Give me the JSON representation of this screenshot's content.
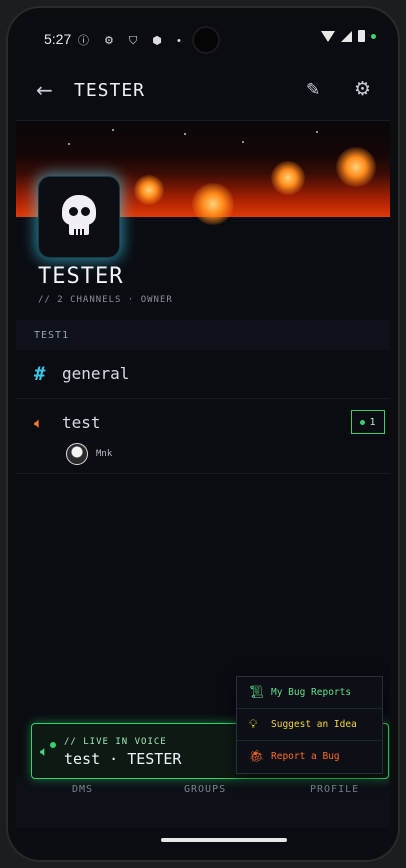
{
  "status_bar": {
    "time": "5:27",
    "icons": "ⓘ ⚙ ⛉ ⬢ •"
  },
  "app_bar": {
    "title": "TESTER"
  },
  "server": {
    "name": "TESTER",
    "meta": "// 2 CHANNELS · OWNER"
  },
  "category": {
    "label": "TEST1"
  },
  "channels": [
    {
      "name": "general",
      "type": "text",
      "icon": "hash-icon"
    },
    {
      "name": "test",
      "type": "voice",
      "icon": "speaker-icon",
      "count": "1",
      "users": [
        {
          "name": "Mnk"
        }
      ]
    }
  ],
  "live_voice": {
    "label": "// LIVE IN VOICE",
    "channel": "test · TESTER"
  },
  "menu": {
    "items": [
      {
        "label": "My Bug Reports",
        "icon": "scroll-icon",
        "color": "#5fe08a"
      },
      {
        "label": "Suggest an Idea",
        "icon": "lightbulb-icon",
        "color": "#f2d33a"
      },
      {
        "label": "Report a Bug",
        "icon": "bug-icon",
        "color": "#ff6a2a"
      }
    ]
  },
  "bottom_nav": {
    "items": [
      "DMS",
      "GROUPS",
      "PROFILE"
    ]
  },
  "colors": {
    "accent_cyan": "#3cc7e8",
    "voice_green": "#2fd36a",
    "voice_orange": "#ff7a2e"
  }
}
